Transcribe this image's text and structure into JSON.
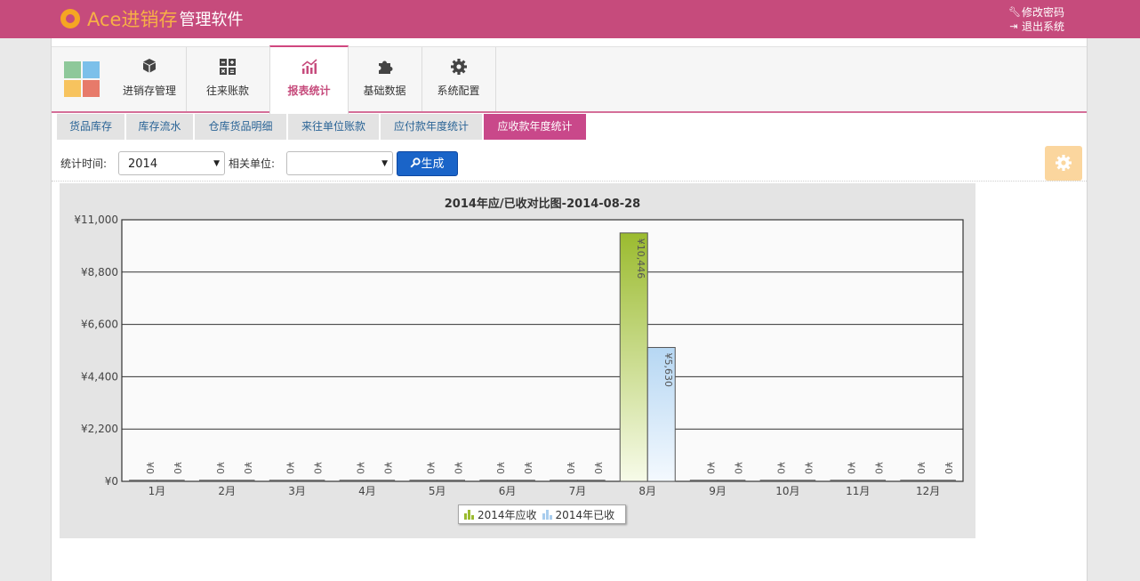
{
  "header": {
    "brand_ace": "Ace进销存",
    "brand_rest": "管理软件",
    "change_password": "修改密码",
    "logout": "退出系统"
  },
  "nav": {
    "items": [
      {
        "label": "进销存管理",
        "icon": "cube-icon"
      },
      {
        "label": "往来账款",
        "icon": "calculator-icon"
      },
      {
        "label": "报表统计",
        "icon": "chart-icon"
      },
      {
        "label": "基础数据",
        "icon": "puzzle-icon"
      },
      {
        "label": "系统配置",
        "icon": "gear-icon"
      }
    ],
    "active_index": 2
  },
  "subtabs": {
    "items": [
      "货品库存",
      "库存流水",
      "仓库货品明细",
      "来往单位账款",
      "应付款年度统计",
      "应收款年度统计"
    ],
    "active_index": 5
  },
  "filter": {
    "time_label": "统计时间:",
    "year_value": "2014",
    "unit_label": "相关单位:",
    "unit_value": "",
    "generate_label": "生成"
  },
  "colors": {
    "header_bg": "#c64b7c",
    "active_subtab": "#c9488a",
    "series_receivable": "#9bbb2f",
    "series_received": "#b8d8f3"
  },
  "chart_data": {
    "type": "bar",
    "title": "2014年应/已收对比图-2014-08-28",
    "categories": [
      "1月",
      "2月",
      "3月",
      "4月",
      "5月",
      "6月",
      "7月",
      "8月",
      "9月",
      "10月",
      "11月",
      "12月"
    ],
    "series": [
      {
        "name": "2014年应收",
        "values": [
          0,
          0,
          0,
          0,
          0,
          0,
          0,
          10446,
          0,
          0,
          0,
          0
        ]
      },
      {
        "name": "2014年已收",
        "values": [
          0,
          0,
          0,
          0,
          0,
          0,
          0,
          5630,
          0,
          0,
          0,
          0
        ]
      }
    ],
    "data_labels": {
      "2014年应收": [
        "¥0",
        "¥0",
        "¥0",
        "¥0",
        "¥0",
        "¥0",
        "¥0",
        "¥10,446",
        "¥0",
        "¥0",
        "¥0",
        "¥0"
      ],
      "2014年已收": [
        "¥0",
        "¥0",
        "¥0",
        "¥0",
        "¥0",
        "¥0",
        "¥0",
        "¥5,630",
        "¥0",
        "¥0",
        "¥0",
        "¥0"
      ]
    },
    "y_ticks": [
      "¥0",
      "¥2,200",
      "¥4,400",
      "¥6,600",
      "¥8,800",
      "¥11,000"
    ],
    "ylim": [
      0,
      11000
    ],
    "grid": true,
    "legend_position": "bottom-center"
  }
}
